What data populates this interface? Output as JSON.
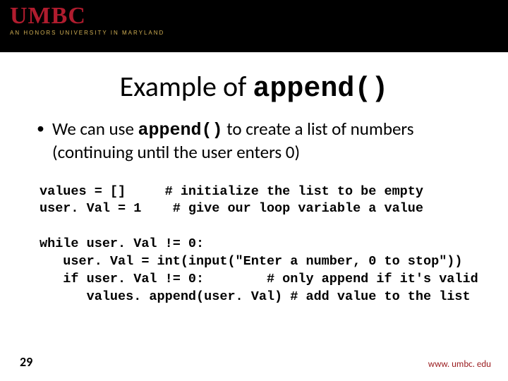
{
  "header": {
    "logo_main": "UMBC",
    "logo_tag": "AN HONORS UNIVERSITY IN MARYLAND"
  },
  "title": {
    "prefix": "Example of ",
    "code": "append()"
  },
  "bullet": {
    "lead": "We can use ",
    "code": "append()",
    "tail": " to create a list of numbers (continuing until the user enters 0)"
  },
  "code_block": "values = []     # initialize the list to be empty\nuser. Val = 1    # give our loop variable a value\n\nwhile user. Val != 0:\n   user. Val = int(input(\"Enter a number, 0 to stop\"))\n   if user. Val != 0:        # only append if it's valid\n      values. append(user. Val) # add value to the list",
  "footer": {
    "page": "29",
    "site": "www. umbc. edu"
  }
}
